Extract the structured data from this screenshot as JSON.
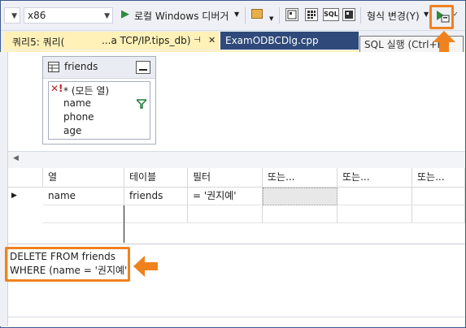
{
  "toolbar": {
    "platform_value": "x86",
    "debugger_label": "로컬 Windows 디버거",
    "format_change_label": "형식 변경(Y)",
    "sql_button_label": "SQL"
  },
  "tabs": [
    {
      "label": "쿼리5: 쿼리(",
      "suffix": "...a TCP/IP.tips_db)",
      "pin": "⊣",
      "close": "✕"
    },
    {
      "label": "ExamODBCDlg.cpp"
    }
  ],
  "tooltip": "SQL 실행 (Ctrl+R)",
  "diagram": {
    "table_name": "friends",
    "columns": [
      "* (모든 열)",
      "name",
      "phone",
      "age"
    ]
  },
  "grid": {
    "headers": [
      "열",
      "테이블",
      "필터",
      "또는...",
      "또는...",
      "또는..."
    ],
    "rows": [
      {
        "column": "name",
        "table": "friends",
        "filter": "= '권지예'"
      }
    ]
  },
  "sql": {
    "line1": "DELETE FROM friends",
    "line2": "WHERE  (name = '권지예')"
  },
  "colors": {
    "highlight": "#f0821e",
    "active_tab": "#fff1b8",
    "inactive_tab": "#2f4a7a"
  }
}
